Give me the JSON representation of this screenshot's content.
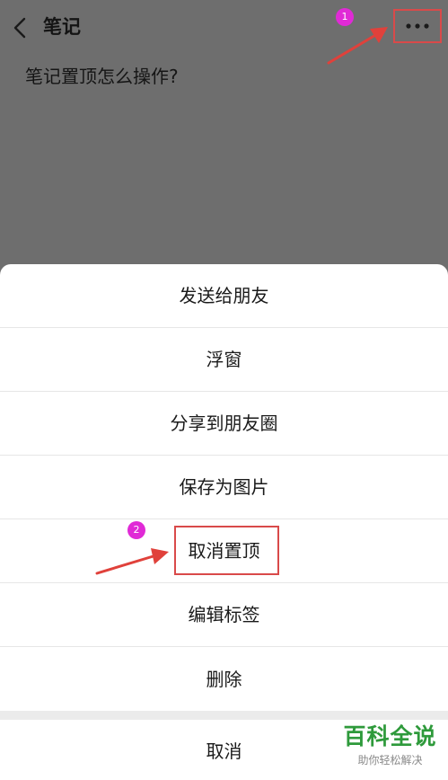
{
  "header": {
    "title": "笔记",
    "back_icon": "chevron-left-icon",
    "more_icon": "more-horizontal-icon"
  },
  "note": {
    "text": "笔记置顶怎么操作?"
  },
  "annotations": {
    "badge_1": "1",
    "badge_2": "2",
    "highlight_color": "#d94a4a",
    "badge_color": "#e02ad6"
  },
  "sheet": {
    "items": [
      {
        "label": "发送给朋友"
      },
      {
        "label": "浮窗"
      },
      {
        "label": "分享到朋友圈"
      },
      {
        "label": "保存为图片"
      },
      {
        "label": "取消置顶"
      },
      {
        "label": "编辑标签"
      },
      {
        "label": "删除"
      }
    ],
    "cancel_label": "取消"
  },
  "watermark": {
    "main": "百科全说",
    "sub": "助你轻松解决",
    "color": "#2e9a3b"
  }
}
